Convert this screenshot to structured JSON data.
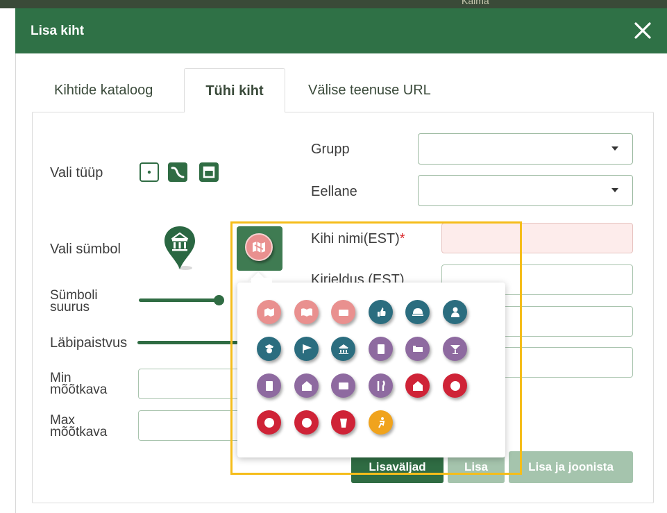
{
  "background": {
    "map_text": "Kalma"
  },
  "dialog": {
    "title": "Lisa kiht"
  },
  "tabs": [
    {
      "label": "Kihtide kataloog"
    },
    {
      "label": "Tühi kiht",
      "active": true
    },
    {
      "label": "Välise teenuse URL"
    }
  ],
  "form": {
    "type_label": "Vali tüüp",
    "type_icons": [
      "point-type-icon",
      "line-type-icon",
      "polygon-type-icon"
    ],
    "symbol_label": "Vali sümbol",
    "symbol_size_label_1": "Sümboli",
    "symbol_size_label_2": "suurus",
    "symbol_size_value": 0.97,
    "opacity_label": "Läbipaistvus",
    "min_scale_label_1": "Min",
    "min_scale_label_2": "mõõtkava",
    "max_scale_label_1": "Max",
    "max_scale_label_2": "mõõtkava",
    "group_label": "Grupp",
    "group_value": "",
    "parent_label": "Eellane",
    "parent_value": "",
    "layer_name_label": "Kihi nimi(EST)",
    "required_mark": "*",
    "layer_name_value": "",
    "description_label": "Kirjeldus (EST)",
    "description_value": ""
  },
  "buttons": {
    "extra_fields": "Lisaväljad",
    "add": "Lisa",
    "add_and_draw": "Lisa ja joonista"
  },
  "colors": {
    "header": "#2f7146",
    "accent": "#2f6c43",
    "highlight": "#f5bd1a",
    "symbol_pink": "#e9908f",
    "symbol_teal": "#2b6d7f",
    "symbol_purple": "#8e6aa0",
    "symbol_red": "#cf2337",
    "symbol_orange": "#f0a31d"
  },
  "symbol_picker": {
    "selected": "map-symbol",
    "symbols": [
      {
        "name": "map-symbol",
        "color": "#e9908f"
      },
      {
        "name": "book-symbol",
        "color": "#e9908f"
      },
      {
        "name": "bed-symbol",
        "color": "#e9908f"
      },
      {
        "name": "thumbs-up-symbol",
        "color": "#2b6d7f"
      },
      {
        "name": "helmet-symbol",
        "color": "#2b6d7f"
      },
      {
        "name": "doctor-symbol",
        "color": "#2b6d7f"
      },
      {
        "name": "police-symbol",
        "color": "#2b6d7f"
      },
      {
        "name": "flag-symbol",
        "color": "#2b6d7f"
      },
      {
        "name": "museum-symbol",
        "color": "#2b6d7f"
      },
      {
        "name": "calculator-symbol",
        "color": "#8e6aa0"
      },
      {
        "name": "hotel-bed-symbol",
        "color": "#8e6aa0"
      },
      {
        "name": "cocktail-symbol",
        "color": "#8e6aa0"
      },
      {
        "name": "atm-symbol",
        "color": "#8e6aa0"
      },
      {
        "name": "euro-house-symbol",
        "color": "#8e6aa0"
      },
      {
        "name": "mail-symbol",
        "color": "#8e6aa0"
      },
      {
        "name": "restaurant-symbol",
        "color": "#8e6aa0"
      },
      {
        "name": "hospital-symbol",
        "color": "#cf2337"
      },
      {
        "name": "person-symbol",
        "color": "#cf2337"
      },
      {
        "name": "first-aid-symbol",
        "color": "#cf2337"
      },
      {
        "name": "medical-symbol",
        "color": "#cf2337"
      },
      {
        "name": "pharmacy-symbol",
        "color": "#cf2337"
      },
      {
        "name": "running-symbol",
        "color": "#f0a31d"
      }
    ]
  }
}
